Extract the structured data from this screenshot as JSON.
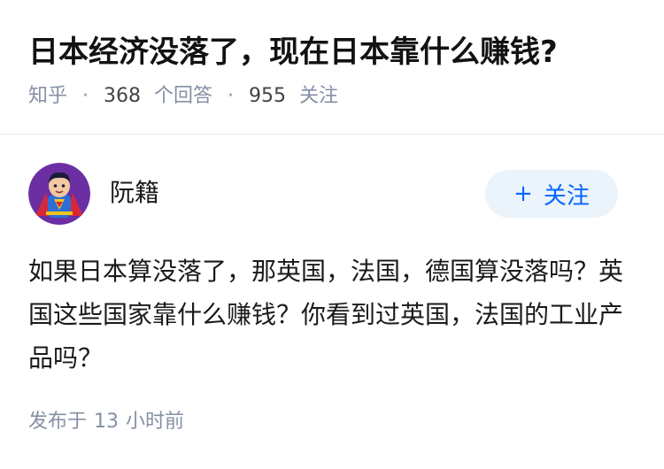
{
  "question": {
    "title": "日本经济没落了，现在日本靠什么赚钱?",
    "source": "知乎",
    "answers_count": "368",
    "answers_unit": "个回答",
    "followers_count": "955",
    "followers_unit": "关注"
  },
  "answer": {
    "author_name": "阮籍",
    "avatar_icon": "superhero-avatar-icon",
    "follow_label": "关注",
    "follow_icon": "plus-icon",
    "content": "如果日本算没落了，那英国，法国，德国算没落吗？英国这些国家靠什么赚钱？你看到过英国，法国的工业产品吗？",
    "published_prefix": "发布于",
    "published_num": "13",
    "published_suffix": "小时前"
  },
  "colors": {
    "accent": "#0066ff",
    "follow_bg": "#ebf3fb",
    "meta_gray": "#8590a6",
    "avatar_bg": "#6b2fa3"
  }
}
